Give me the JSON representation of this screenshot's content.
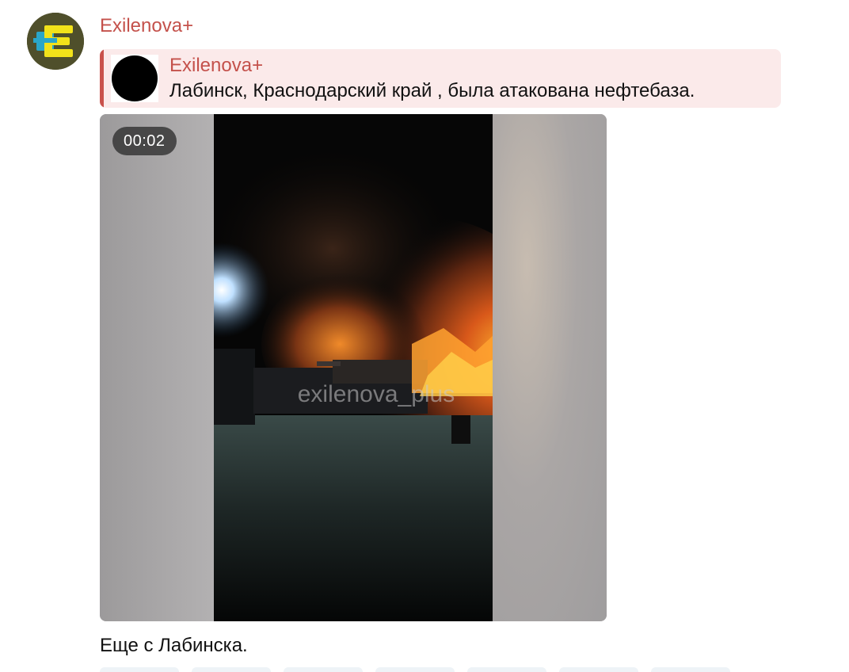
{
  "post": {
    "author": "Exilenova+",
    "caption": "Еще с Лабинска."
  },
  "reply": {
    "author": "Exilenova+",
    "text": "Лабинск, Краснодарский край , была атакована нефтебаза."
  },
  "video": {
    "duration": "00:02",
    "watermark": "exilenova_plus"
  },
  "icons": {
    "avatar": "channel-logo-icon",
    "reply_thumbnail": "reply-thumbnail-icon"
  },
  "colors": {
    "author_name": "#c4514b",
    "reply_background": "#fbeaea",
    "reply_bar": "#c9524c",
    "avatar_background": "#4f4f2b",
    "logo_yellow": "#f2e21a",
    "logo_blue": "#2aa6c8"
  }
}
